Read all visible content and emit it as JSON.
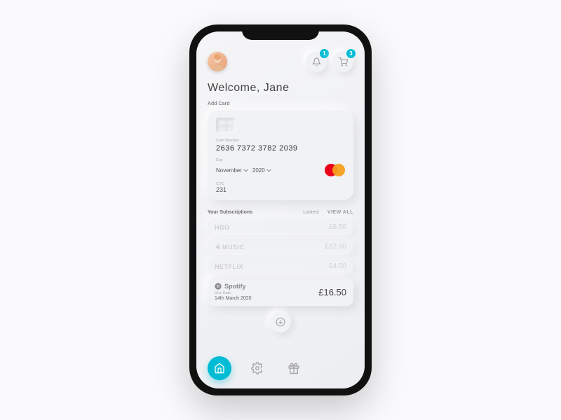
{
  "colors": {
    "accent": "#00bcd4"
  },
  "header": {
    "notifications_badge": "1",
    "cart_badge": "3",
    "welcome": "Welcome, Jane"
  },
  "card": {
    "section_label": "Add Card",
    "number_label": "Card Number",
    "number": "2636 7372 3782 2039",
    "exp_label": "Exp",
    "exp_month": "November",
    "exp_year": "2020",
    "cvc_label": "CVC",
    "cvc": "231"
  },
  "subscriptions": {
    "title": "Your Subscriptions",
    "sort": "Lastest",
    "view_all": "VIEW ALL",
    "items": [
      {
        "brand": "HBO",
        "price": "£9.50"
      },
      {
        "brand": "MUSIC",
        "price": "£12.50"
      },
      {
        "brand": "NETFLIX",
        "price": "£4.50"
      },
      {
        "brand": "Spotify",
        "due_label": "Due Date",
        "due_date": "14th March 2020",
        "price": "£16.50"
      }
    ]
  }
}
